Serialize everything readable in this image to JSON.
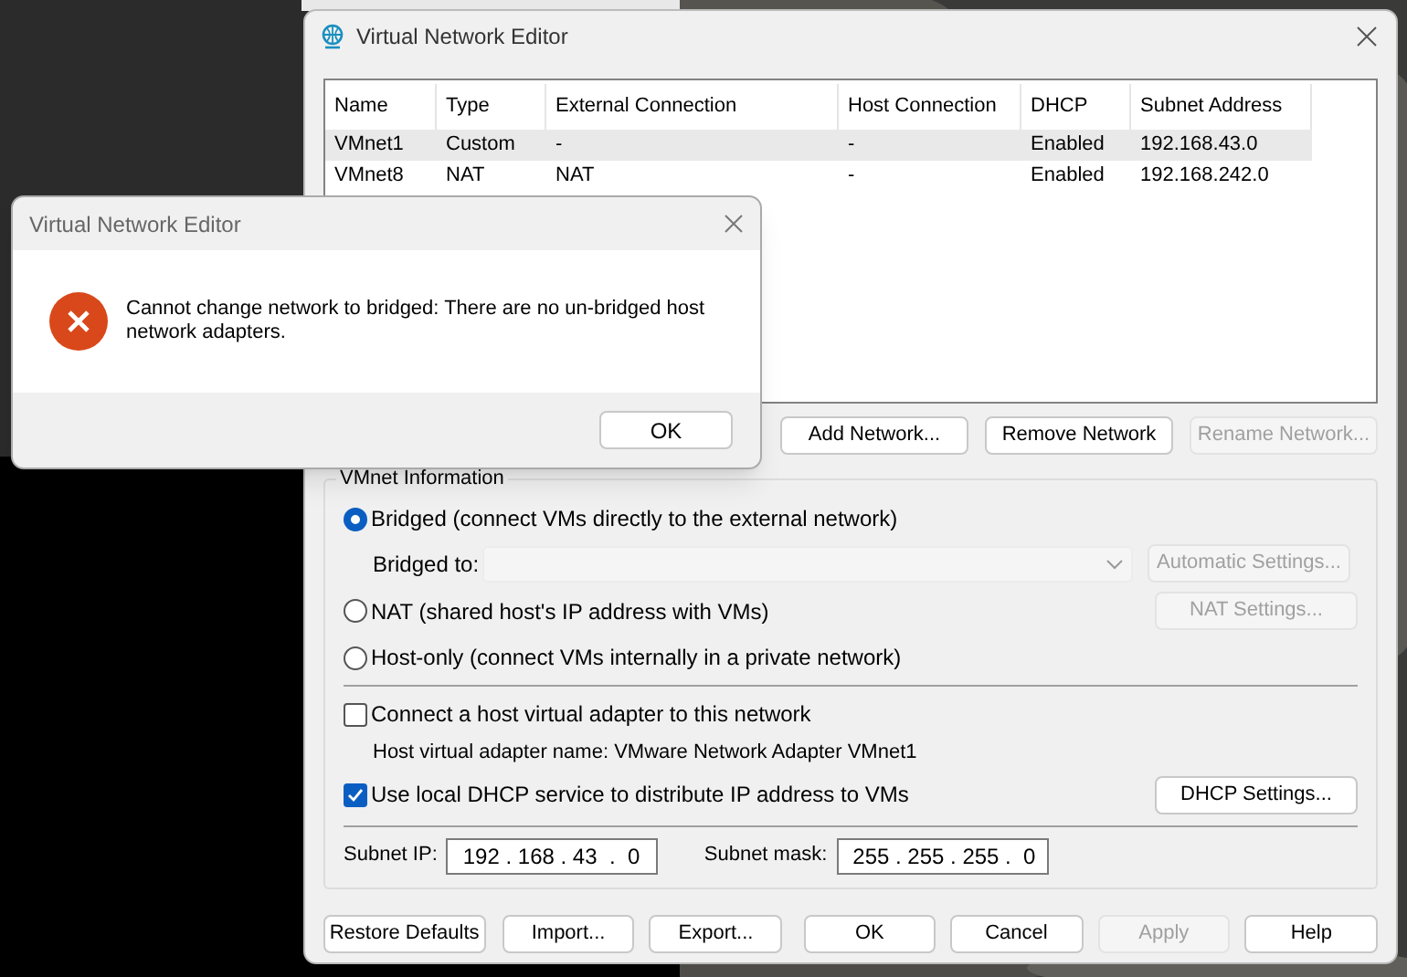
{
  "main_window": {
    "title": "Virtual Network Editor",
    "table": {
      "columns": [
        "Name",
        "Type",
        "External Connection",
        "Host Connection",
        "DHCP",
        "Subnet Address"
      ],
      "rows": [
        {
          "selected": true,
          "cells": [
            "VMnet1",
            "Custom",
            "-",
            "-",
            "Enabled",
            "192.168.43.0"
          ]
        },
        {
          "selected": false,
          "cells": [
            "VMnet8",
            "NAT",
            "NAT",
            "-",
            "Enabled",
            "192.168.242.0"
          ]
        }
      ]
    },
    "list_buttons": [
      {
        "label": "Add Network...",
        "disabled": false
      },
      {
        "label": "Remove Network",
        "disabled": false
      },
      {
        "label": "Rename Network...",
        "disabled": true
      }
    ],
    "vmnet_info": {
      "title": "VMnet Information",
      "modes": [
        {
          "label": "Bridged (connect VMs directly to the external network)",
          "selected": true
        },
        {
          "label": "NAT (shared host's IP address with VMs)",
          "selected": false
        },
        {
          "label": "Host-only (connect VMs internally in a private network)",
          "selected": false
        }
      ],
      "bridged_to_label": "Bridged to:",
      "automatic_settings": {
        "label": "Automatic Settings...",
        "disabled": true
      },
      "nat_settings": {
        "label": "NAT Settings...",
        "disabled": true
      },
      "connect_adapter": {
        "label": "Connect a host virtual adapter to this network",
        "checked": false
      },
      "adapter_name": "Host virtual adapter name: VMware Network Adapter VMnet1",
      "use_dhcp": {
        "label": "Use local DHCP service to distribute IP address to VMs",
        "checked": true
      },
      "dhcp_settings": {
        "label": "DHCP Settings...",
        "disabled": false
      },
      "subnet_ip_label": "Subnet IP:",
      "subnet_ip": "192 . 168 . 43  .  0",
      "subnet_mask_label": "Subnet mask:",
      "subnet_mask": "255 . 255 . 255 .  0"
    },
    "bottom_buttons": [
      {
        "label": "Restore Defaults",
        "disabled": false
      },
      {
        "label": "Import...",
        "disabled": false
      },
      {
        "label": "Export...",
        "disabled": false
      },
      {
        "label": "OK",
        "disabled": false
      },
      {
        "label": "Cancel",
        "disabled": false
      },
      {
        "label": "Apply",
        "disabled": true
      },
      {
        "label": "Help",
        "disabled": false
      }
    ]
  },
  "error_dialog": {
    "title": "Virtual Network Editor",
    "message": "Cannot change network to bridged: There are no un-bridged host network adapters.",
    "button": "OK"
  }
}
